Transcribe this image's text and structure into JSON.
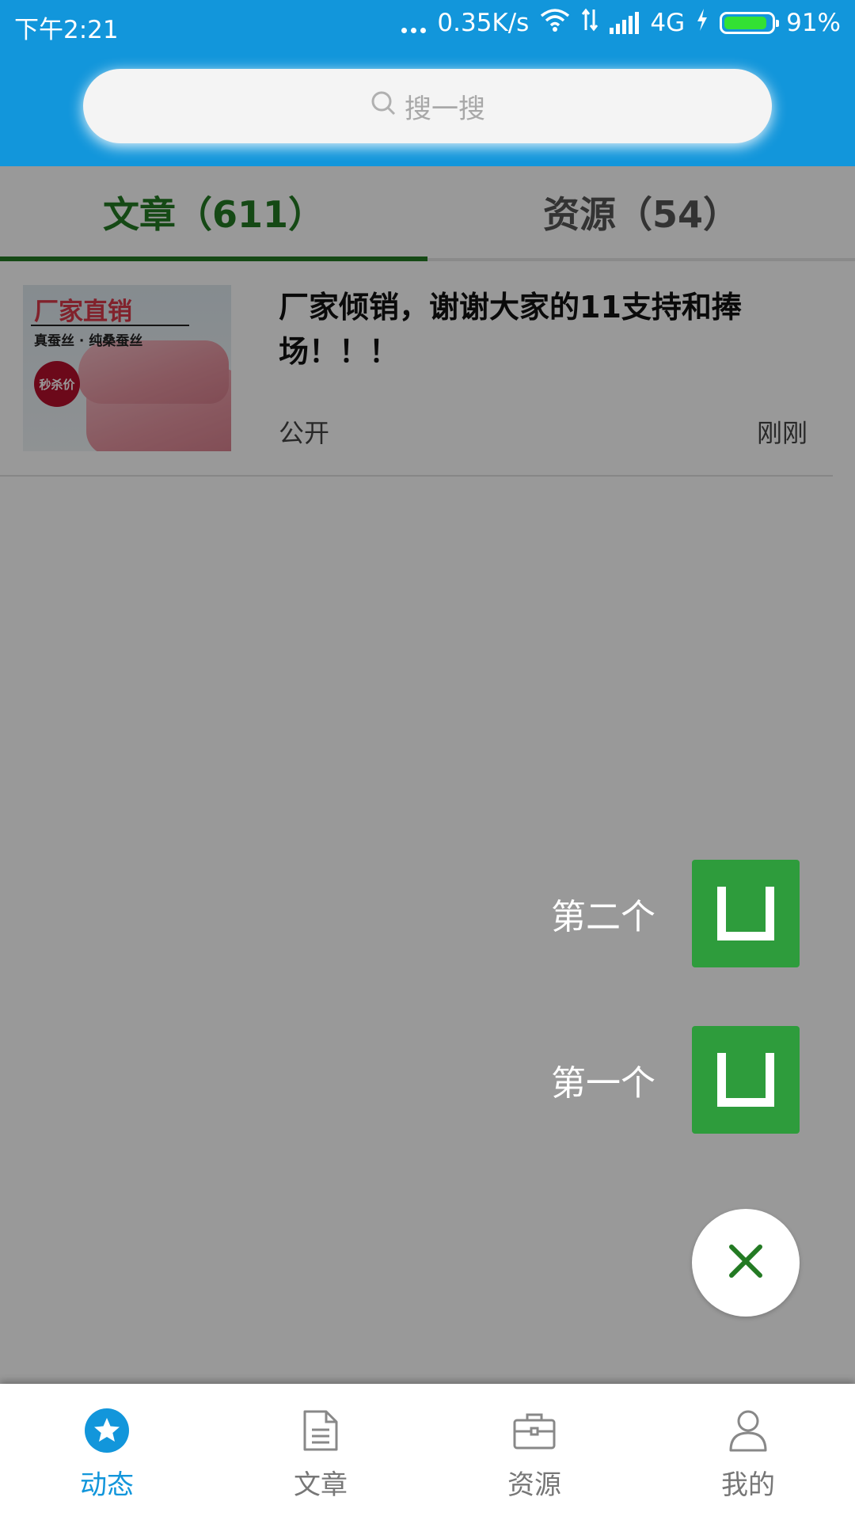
{
  "status_bar": {
    "time": "下午2:21",
    "network_speed": "0.35K/s",
    "network_type": "4G",
    "battery": "91%"
  },
  "search": {
    "placeholder": "搜一搜"
  },
  "tabs": [
    {
      "label": "文章（611）",
      "active": true
    },
    {
      "label": "资源（54）",
      "active": false
    }
  ],
  "article": {
    "title": "厂家倾销，谢谢大家的11支持和捧场！！！",
    "visibility": "公开",
    "time": "刚刚",
    "thumbnail": {
      "headline": "厂家直销",
      "subline": "真蚕丝 · 纯桑蚕丝",
      "badge": "秒杀价"
    }
  },
  "fab_menu": {
    "items": [
      {
        "label": "第二个"
      },
      {
        "label": "第一个"
      }
    ]
  },
  "bottom_nav": {
    "items": [
      {
        "label": "动态",
        "icon": "star-icon",
        "active": true
      },
      {
        "label": "文章",
        "icon": "document-icon",
        "active": false
      },
      {
        "label": "资源",
        "icon": "briefcase-icon",
        "active": false
      },
      {
        "label": "我的",
        "icon": "user-icon",
        "active": false
      }
    ]
  },
  "colors": {
    "primary_blue": "#1296db",
    "tab_green": "#237a23",
    "fab_green": "#2e9c3c"
  }
}
